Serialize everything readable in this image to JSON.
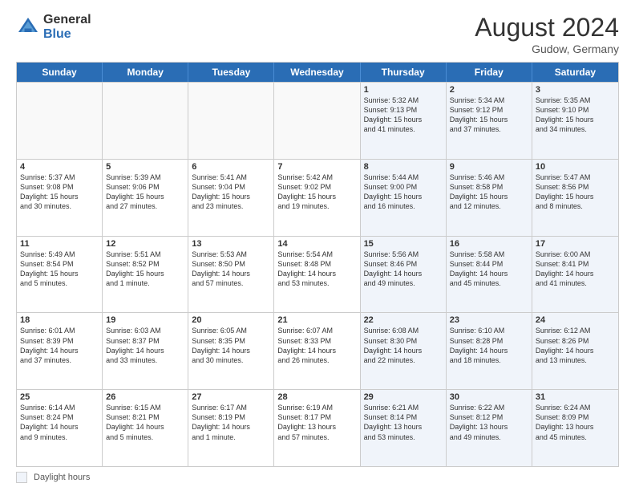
{
  "logo": {
    "general": "General",
    "blue": "Blue"
  },
  "title": "August 2024",
  "location": "Gudow, Germany",
  "days_of_week": [
    "Sunday",
    "Monday",
    "Tuesday",
    "Wednesday",
    "Thursday",
    "Friday",
    "Saturday"
  ],
  "legend_label": "Daylight hours",
  "weeks": [
    [
      {
        "day": "",
        "info": "",
        "shaded": false,
        "empty": true
      },
      {
        "day": "",
        "info": "",
        "shaded": false,
        "empty": true
      },
      {
        "day": "",
        "info": "",
        "shaded": false,
        "empty": true
      },
      {
        "day": "",
        "info": "",
        "shaded": false,
        "empty": true
      },
      {
        "day": "1",
        "info": "Sunrise: 5:32 AM\nSunset: 9:13 PM\nDaylight: 15 hours\nand 41 minutes.",
        "shaded": true
      },
      {
        "day": "2",
        "info": "Sunrise: 5:34 AM\nSunset: 9:12 PM\nDaylight: 15 hours\nand 37 minutes.",
        "shaded": true
      },
      {
        "day": "3",
        "info": "Sunrise: 5:35 AM\nSunset: 9:10 PM\nDaylight: 15 hours\nand 34 minutes.",
        "shaded": true
      }
    ],
    [
      {
        "day": "4",
        "info": "Sunrise: 5:37 AM\nSunset: 9:08 PM\nDaylight: 15 hours\nand 30 minutes.",
        "shaded": false
      },
      {
        "day": "5",
        "info": "Sunrise: 5:39 AM\nSunset: 9:06 PM\nDaylight: 15 hours\nand 27 minutes.",
        "shaded": false
      },
      {
        "day": "6",
        "info": "Sunrise: 5:41 AM\nSunset: 9:04 PM\nDaylight: 15 hours\nand 23 minutes.",
        "shaded": false
      },
      {
        "day": "7",
        "info": "Sunrise: 5:42 AM\nSunset: 9:02 PM\nDaylight: 15 hours\nand 19 minutes.",
        "shaded": false
      },
      {
        "day": "8",
        "info": "Sunrise: 5:44 AM\nSunset: 9:00 PM\nDaylight: 15 hours\nand 16 minutes.",
        "shaded": true
      },
      {
        "day": "9",
        "info": "Sunrise: 5:46 AM\nSunset: 8:58 PM\nDaylight: 15 hours\nand 12 minutes.",
        "shaded": true
      },
      {
        "day": "10",
        "info": "Sunrise: 5:47 AM\nSunset: 8:56 PM\nDaylight: 15 hours\nand 8 minutes.",
        "shaded": true
      }
    ],
    [
      {
        "day": "11",
        "info": "Sunrise: 5:49 AM\nSunset: 8:54 PM\nDaylight: 15 hours\nand 5 minutes.",
        "shaded": false
      },
      {
        "day": "12",
        "info": "Sunrise: 5:51 AM\nSunset: 8:52 PM\nDaylight: 15 hours\nand 1 minute.",
        "shaded": false
      },
      {
        "day": "13",
        "info": "Sunrise: 5:53 AM\nSunset: 8:50 PM\nDaylight: 14 hours\nand 57 minutes.",
        "shaded": false
      },
      {
        "day": "14",
        "info": "Sunrise: 5:54 AM\nSunset: 8:48 PM\nDaylight: 14 hours\nand 53 minutes.",
        "shaded": false
      },
      {
        "day": "15",
        "info": "Sunrise: 5:56 AM\nSunset: 8:46 PM\nDaylight: 14 hours\nand 49 minutes.",
        "shaded": true
      },
      {
        "day": "16",
        "info": "Sunrise: 5:58 AM\nSunset: 8:44 PM\nDaylight: 14 hours\nand 45 minutes.",
        "shaded": true
      },
      {
        "day": "17",
        "info": "Sunrise: 6:00 AM\nSunset: 8:41 PM\nDaylight: 14 hours\nand 41 minutes.",
        "shaded": true
      }
    ],
    [
      {
        "day": "18",
        "info": "Sunrise: 6:01 AM\nSunset: 8:39 PM\nDaylight: 14 hours\nand 37 minutes.",
        "shaded": false
      },
      {
        "day": "19",
        "info": "Sunrise: 6:03 AM\nSunset: 8:37 PM\nDaylight: 14 hours\nand 33 minutes.",
        "shaded": false
      },
      {
        "day": "20",
        "info": "Sunrise: 6:05 AM\nSunset: 8:35 PM\nDaylight: 14 hours\nand 30 minutes.",
        "shaded": false
      },
      {
        "day": "21",
        "info": "Sunrise: 6:07 AM\nSunset: 8:33 PM\nDaylight: 14 hours\nand 26 minutes.",
        "shaded": false
      },
      {
        "day": "22",
        "info": "Sunrise: 6:08 AM\nSunset: 8:30 PM\nDaylight: 14 hours\nand 22 minutes.",
        "shaded": true
      },
      {
        "day": "23",
        "info": "Sunrise: 6:10 AM\nSunset: 8:28 PM\nDaylight: 14 hours\nand 18 minutes.",
        "shaded": true
      },
      {
        "day": "24",
        "info": "Sunrise: 6:12 AM\nSunset: 8:26 PM\nDaylight: 14 hours\nand 13 minutes.",
        "shaded": true
      }
    ],
    [
      {
        "day": "25",
        "info": "Sunrise: 6:14 AM\nSunset: 8:24 PM\nDaylight: 14 hours\nand 9 minutes.",
        "shaded": false
      },
      {
        "day": "26",
        "info": "Sunrise: 6:15 AM\nSunset: 8:21 PM\nDaylight: 14 hours\nand 5 minutes.",
        "shaded": false
      },
      {
        "day": "27",
        "info": "Sunrise: 6:17 AM\nSunset: 8:19 PM\nDaylight: 14 hours\nand 1 minute.",
        "shaded": false
      },
      {
        "day": "28",
        "info": "Sunrise: 6:19 AM\nSunset: 8:17 PM\nDaylight: 13 hours\nand 57 minutes.",
        "shaded": false
      },
      {
        "day": "29",
        "info": "Sunrise: 6:21 AM\nSunset: 8:14 PM\nDaylight: 13 hours\nand 53 minutes.",
        "shaded": true
      },
      {
        "day": "30",
        "info": "Sunrise: 6:22 AM\nSunset: 8:12 PM\nDaylight: 13 hours\nand 49 minutes.",
        "shaded": true
      },
      {
        "day": "31",
        "info": "Sunrise: 6:24 AM\nSunset: 8:09 PM\nDaylight: 13 hours\nand 45 minutes.",
        "shaded": true
      }
    ]
  ]
}
